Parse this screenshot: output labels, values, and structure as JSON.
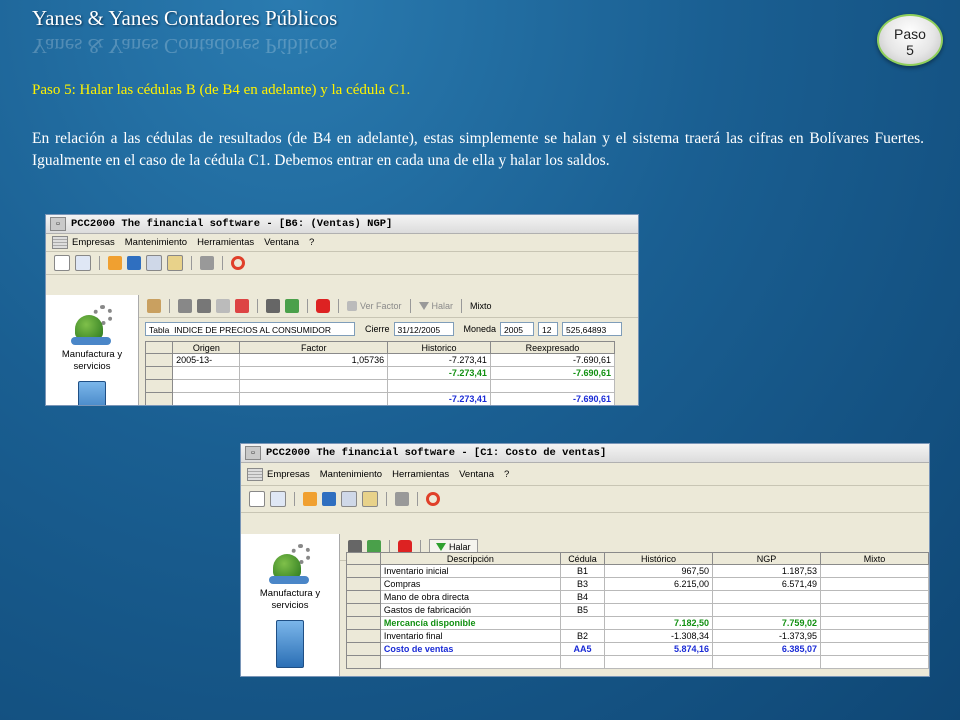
{
  "slide": {
    "title": "Yanes & Yanes Contadores Públicos",
    "badge_line1": "Paso",
    "badge_line2": "5",
    "step_heading": "Paso 5: Halar las cédulas B (de B4 en adelante) y la cédula C1.",
    "body": "En relación a las cédulas de resultados (de B4 en adelante), estas simplemente se halan y el sistema traerá las cifras en Bolívares Fuertes. Igualmente en el caso de la cédula C1. Debemos entrar en cada una de ella y halar los saldos."
  },
  "window1": {
    "title": "PCC2000 The financial software - [B6: (Ventas) NGP]",
    "menu": [
      "Empresas",
      "Mantenimiento",
      "Herramientas",
      "Ventana",
      "?"
    ],
    "left_panel_label": "Manufactura y servicios",
    "buttons": {
      "ver_factor": "Ver Factor",
      "halar": "Halar",
      "mixto": "Mixto"
    },
    "fields": {
      "tabla_label": "Tabla",
      "tabla_value": "INDICE DE PRECIOS AL CONSUMIDOR",
      "cierre_label": "Cierre",
      "cierre_value": "31/12/2005",
      "moneda_label": "Moneda",
      "moneda_year": "2005",
      "moneda_month": "12",
      "moneda_value": "525,64893"
    },
    "columns": [
      "Origen",
      "Factor",
      "Historico",
      "Reexpresado"
    ],
    "rows": [
      {
        "origen": "2005-13-",
        "factor": "1,05736",
        "historico": "-7.273,41",
        "reexpresado": "-7.690,61",
        "style": ""
      },
      {
        "origen": "",
        "factor": "",
        "historico": "-7.273,41",
        "reexpresado": "-7.690,61",
        "style": "green"
      },
      {
        "origen": "",
        "factor": "",
        "historico": "",
        "reexpresado": "",
        "style": ""
      },
      {
        "origen": "",
        "factor": "",
        "historico": "-7.273,41",
        "reexpresado": "-7.690,61",
        "style": "blue"
      },
      {
        "origen": "",
        "factor": "",
        "historico": "",
        "reexpresado": "",
        "style": ""
      }
    ]
  },
  "window2": {
    "title": "PCC2000 The financial software - [C1: Costo de ventas]",
    "menu": [
      "Empresas",
      "Mantenimiento",
      "Herramientas",
      "Ventana",
      "?"
    ],
    "left_panel_label": "Manufactura y servicios",
    "buttons": {
      "halar": "Halar"
    },
    "columns": [
      "Descripción",
      "Cédula",
      "Histórico",
      "NGP",
      "Mixto"
    ],
    "rows": [
      {
        "descripcion": "Inventario inicial",
        "cedula": "B1",
        "historico": "967,50",
        "ngp": "1.187,53",
        "mixto": "",
        "style": ""
      },
      {
        "descripcion": "Compras",
        "cedula": "B3",
        "historico": "6.215,00",
        "ngp": "6.571,49",
        "mixto": "",
        "style": ""
      },
      {
        "descripcion": "Mano de obra directa",
        "cedula": "B4",
        "historico": "",
        "ngp": "",
        "mixto": "",
        "style": ""
      },
      {
        "descripcion": "Gastos de fabricación",
        "cedula": "B5",
        "historico": "",
        "ngp": "",
        "mixto": "",
        "style": ""
      },
      {
        "descripcion": "Mercancía disponible",
        "cedula": "",
        "historico": "7.182,50",
        "ngp": "7.759,02",
        "mixto": "",
        "style": "green"
      },
      {
        "descripcion": "Inventario final",
        "cedula": "B2",
        "historico": "-1.308,34",
        "ngp": "-1.373,95",
        "mixto": "",
        "style": ""
      },
      {
        "descripcion": "Costo de ventas",
        "cedula": "AA5",
        "historico": "5.874,16",
        "ngp": "6.385,07",
        "mixto": "",
        "style": "blue"
      },
      {
        "descripcion": "",
        "cedula": "",
        "historico": "",
        "ngp": "",
        "mixto": "",
        "style": ""
      }
    ]
  },
  "colors": {
    "heading_yellow": "#fff200",
    "total_green": "#119011",
    "total_blue": "#1a2bd6"
  }
}
